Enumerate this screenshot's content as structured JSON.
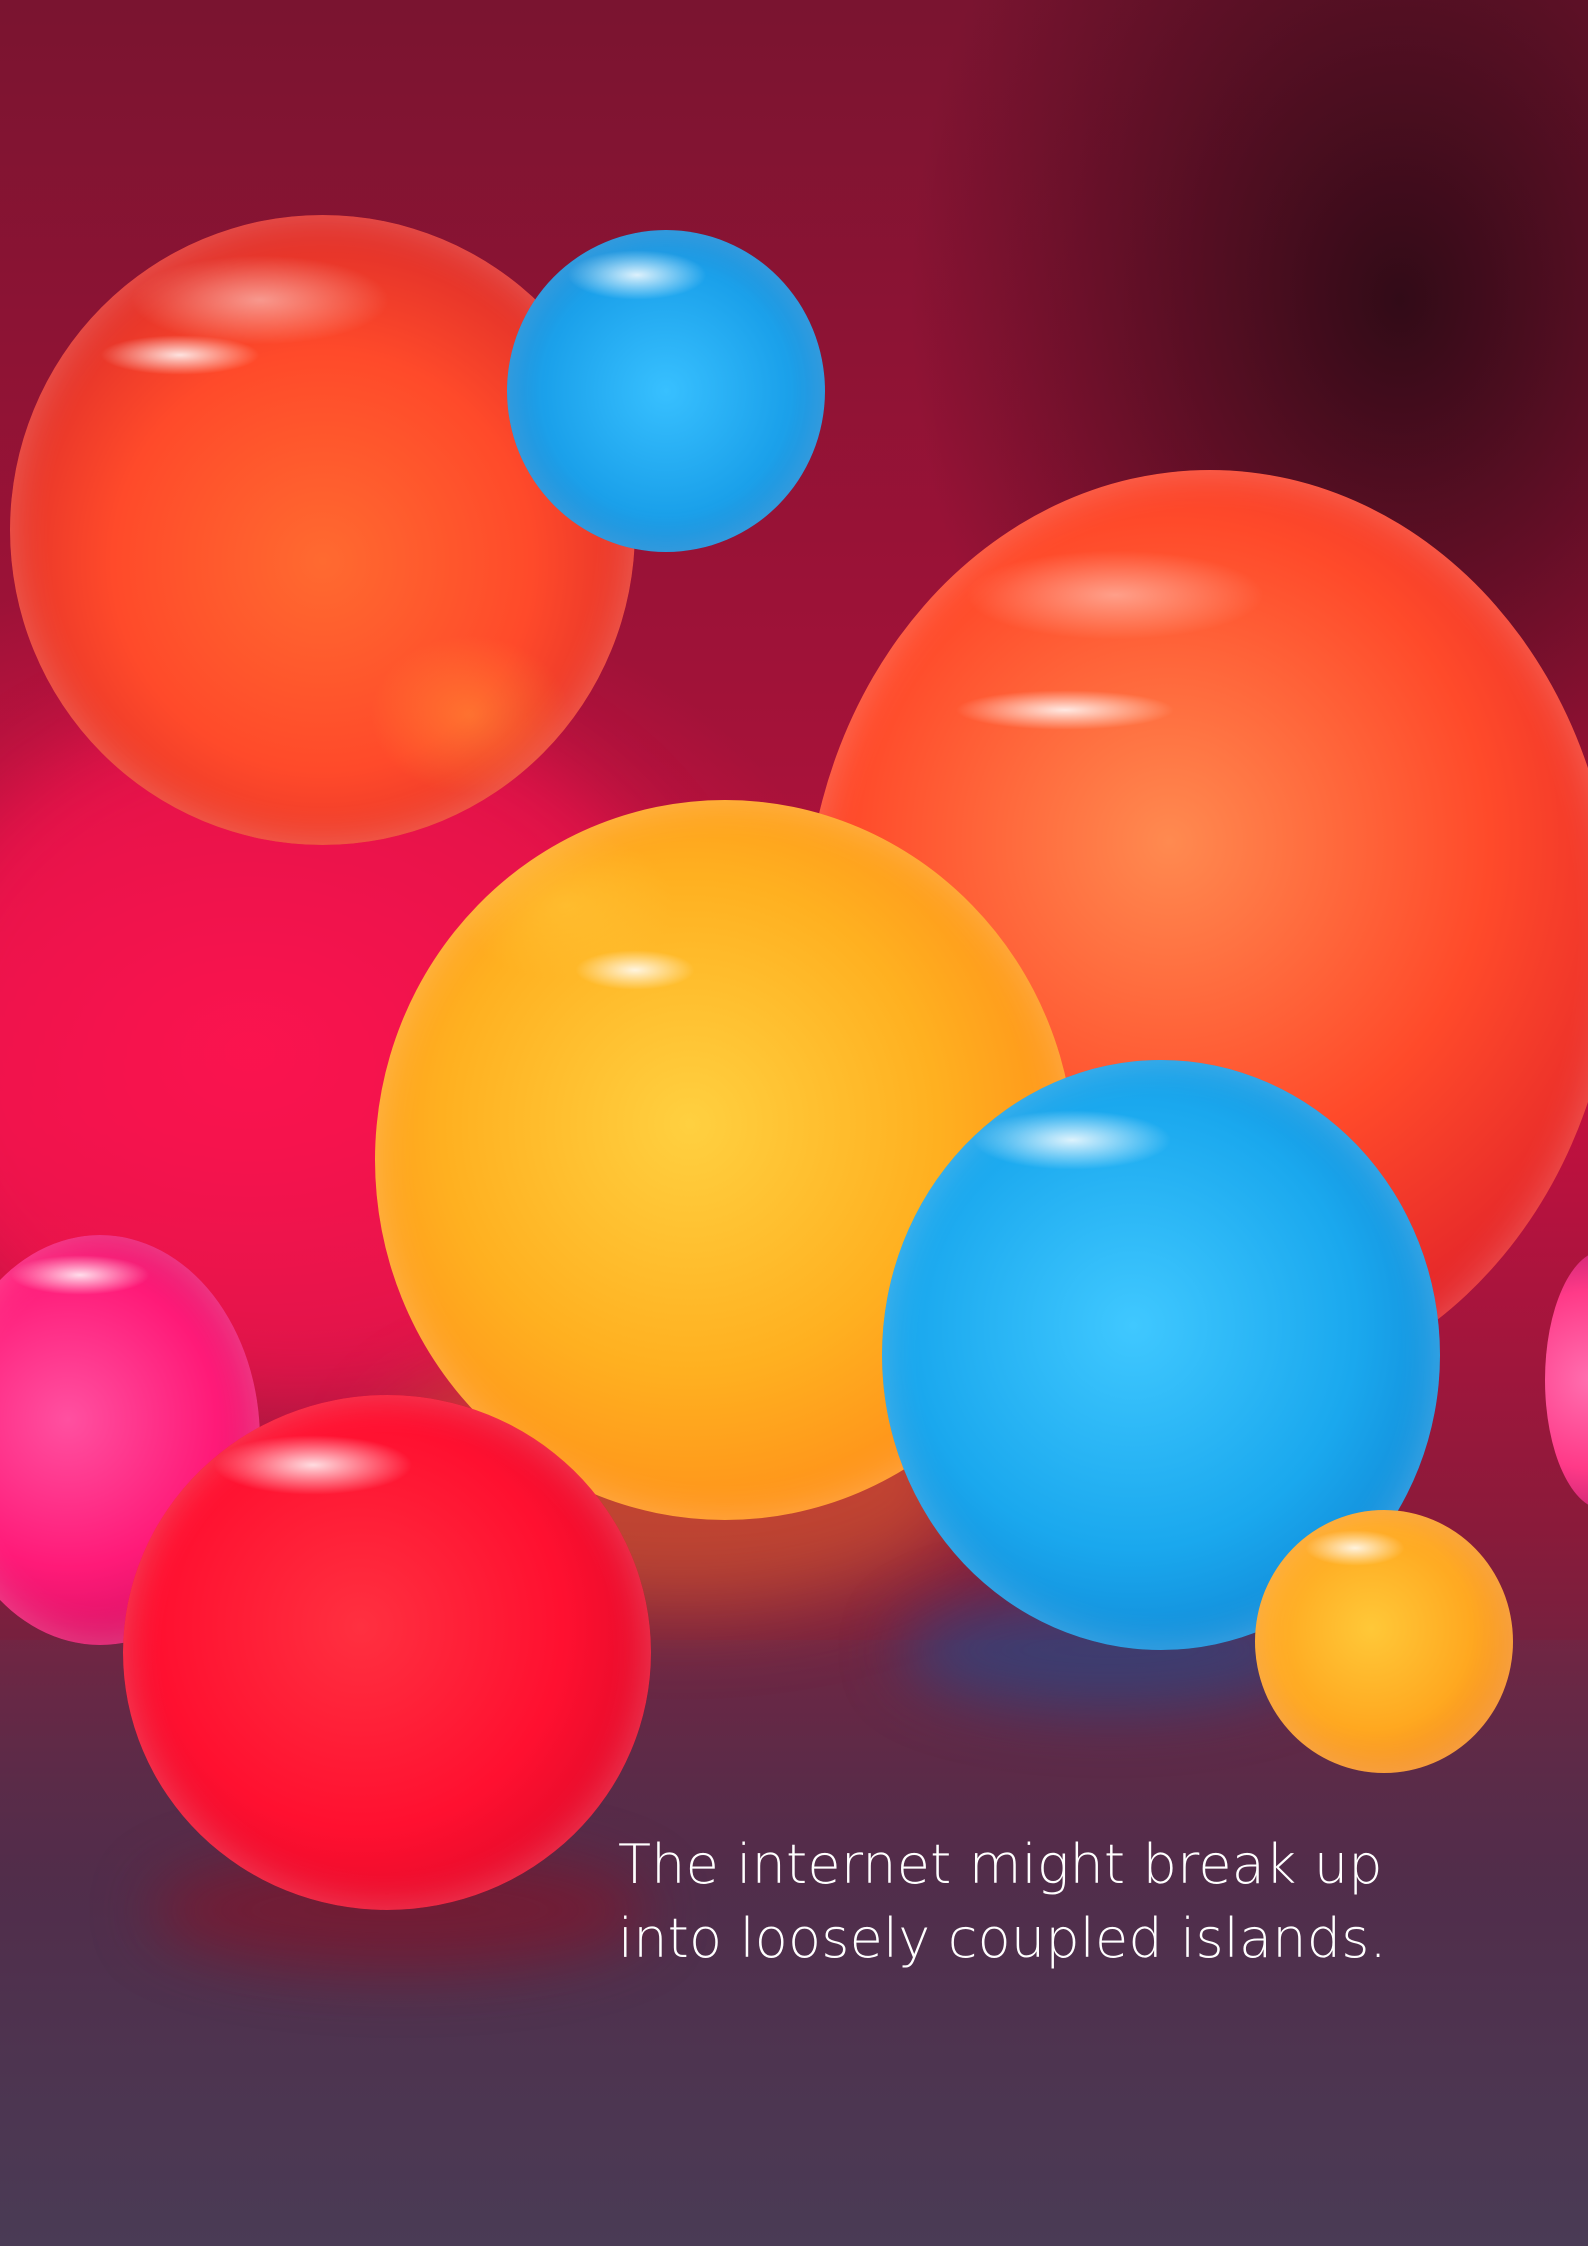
{
  "caption": {
    "line1": "The internet might break up",
    "line2": "into loosely coupled islands."
  },
  "colors": {
    "background_top": "#7a1430",
    "background_mid": "#c0103f",
    "floor": "#4a3b55",
    "sphere_orange": "#ff5a2a",
    "sphere_blue": "#1aa8ee",
    "sphere_yellow": "#ffb020",
    "sphere_red": "#ff1030",
    "sphere_pink": "#ff1a78",
    "text": "#ffffff"
  },
  "scene_elements": [
    "orange-sphere-large",
    "blue-sphere-small",
    "orange-sphere-right",
    "yellow-sphere-center",
    "blue-sphere-right",
    "pink-sphere-left",
    "red-sphere-front",
    "yellow-sphere-small"
  ]
}
